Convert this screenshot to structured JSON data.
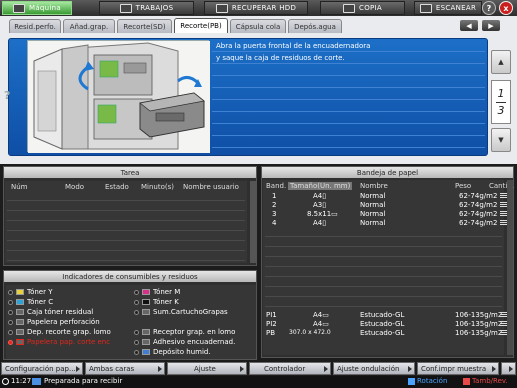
{
  "topbar": {
    "maquina": "Máquina",
    "trabajos": "TRABAJOS",
    "recuperar": "RECUPERAR HDD",
    "copia": "COPIA",
    "escanear": "ESCANEAR",
    "help": "?",
    "close": "x"
  },
  "tabs": [
    {
      "label": "Resid.perfo."
    },
    {
      "label": "Añad.grap."
    },
    {
      "label": "Recorte(SD)"
    },
    {
      "label": "Recorte(PB)"
    },
    {
      "label": "Cápsula cola"
    },
    {
      "label": "Depós.agua"
    }
  ],
  "nav": {
    "prev": "◀",
    "next": "▶"
  },
  "guide": {
    "line1": "Abra la puerta frontal de la encuadernadora",
    "line2": "y saque la caja de residuos de corte.",
    "qmark": "?"
  },
  "pager": {
    "up": "▲",
    "down": "▼",
    "current": "1",
    "total": "3"
  },
  "tarea": {
    "title": "Tarea",
    "headers": [
      "Núm",
      "Modo",
      "Estado",
      "Minuto(s)",
      "Nombre usuario"
    ]
  },
  "bandeja": {
    "title": "Bandeja de papel",
    "headers": [
      "Band.",
      "Tamaño(Un. mm)",
      "Nombre",
      "Peso",
      "Cantid."
    ],
    "rows": [
      {
        "tray": "1",
        "size": "A4▯",
        "name": "Normal",
        "weight": "62-74g/m2"
      },
      {
        "tray": "2",
        "size": "A3▯",
        "name": "Normal",
        "weight": "62-74g/m2"
      },
      {
        "tray": "3",
        "size": "8.5x11▭",
        "name": "Normal",
        "weight": "62-74g/m2"
      },
      {
        "tray": "4",
        "size": "A4▯",
        "name": "Normal",
        "weight": "62-74g/m2"
      }
    ],
    "rows2": [
      {
        "tray": "PI1",
        "size": "A4▭",
        "name": "Estucado-GL",
        "weight": "106-135g/m2"
      },
      {
        "tray": "PI2",
        "size": "A4▭",
        "name": "Estucado-GL",
        "weight": "106-135g/m2"
      },
      {
        "tray": "PB",
        "size": "307.0 x 472.0",
        "name": "Estucado-GL",
        "weight": "106-135g/m2"
      }
    ]
  },
  "consum": {
    "title": "Indicadores de consumibles y residuos",
    "left": [
      {
        "label": "Tóner Y",
        "alert": false
      },
      {
        "label": "Tóner C",
        "alert": false
      },
      {
        "label": "Caja tóner residual",
        "alert": false
      },
      {
        "label": "Papelera perforación",
        "alert": false
      },
      {
        "label": "Dep. recorte grap. lomo",
        "alert": false
      },
      {
        "label": "Papelera pap. corte enc",
        "alert": true
      }
    ],
    "right": [
      {
        "label": "Tóner M",
        "alert": false
      },
      {
        "label": "Tóner K",
        "alert": false
      },
      {
        "label": "Sum.CartuchoGrapas",
        "alert": false
      },
      {
        "label": "",
        "alert": false
      },
      {
        "label": "Receptor grap. en lomo",
        "alert": false
      },
      {
        "label": "Adhesivo encuadernad.",
        "alert": false
      },
      {
        "label": "Depósito humid.",
        "alert": false
      }
    ]
  },
  "functions": [
    {
      "label": "Configuración pap..."
    },
    {
      "label": "Ambas caras"
    },
    {
      "label": "Ajuste"
    },
    {
      "label": "Controlador"
    },
    {
      "label": "Ajuste ondulación"
    },
    {
      "label": "Conf.impr muestra"
    }
  ],
  "status": {
    "time": "11:27",
    "message": "Preparada para recibir",
    "rotacion": "Rotación",
    "tamb": "Tamb/Rev."
  },
  "colors": {
    "accent_green": "#3c9b35",
    "guide_blue": "#1565c0",
    "alert_red": "#e0281c"
  }
}
